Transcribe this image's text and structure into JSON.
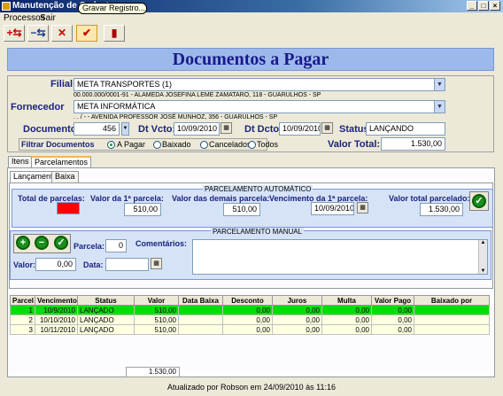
{
  "window": {
    "title": "Manutenção de Cadastro"
  },
  "menu": [
    "Processos",
    "Sair"
  ],
  "toolbar": {
    "tooltip": "Gravar Registro...",
    "buttons": [
      "add-icon",
      "remove-icon",
      "cancel-icon",
      "save-check-icon",
      "exit-door-icon"
    ]
  },
  "heading": "Documentos a Pagar",
  "form": {
    "filial_label": "Filial",
    "filial_value": "META TRANSPORTES (1)",
    "filial_info": "00.000.000/0001-91 - ALAMEDA JOSEFINA LEME ZAMATARO, 118 - GUARULHOS - SP",
    "fornecedor_label": "Fornecedor",
    "fornecedor_value": "META INFORMÁTICA",
    "fornecedor_info": ". . / - - AVENIDA PROFESSOR JOSÉ MUNHOZ, 356 - GUARULHOS - SP",
    "documento_label": "Documento",
    "documento_value": "456",
    "dtvcto_label": "Dt Vcto:",
    "dtvcto_value": "10/09/2010",
    "dtdcto_label": "Dt Dcto:",
    "dtdcto_value": "10/09/2010",
    "status_label": "Status:",
    "status_value": "LANÇANDO",
    "filtrar_label": "Filtrar Documentos",
    "filters": [
      "A Pagar",
      "Baixado",
      "Cancelados",
      "Todos"
    ],
    "filter_selected": "A Pagar",
    "valor_total_label": "Valor Total:",
    "valor_total_value": "1.530,00"
  },
  "tabs": [
    "Itens",
    "Parcelamentos"
  ],
  "subtabs": [
    "Lançamento",
    "Baixa"
  ],
  "auto": {
    "legend": "PARCELAMENTO AUTOMÁTICO",
    "total_parcelas_label": "Total de parcelas:",
    "valor_primeira_label": "Valor da 1ª parcela:",
    "valor_primeira_value": "510,00",
    "valor_demais_label": "Valor das demais parcela:",
    "valor_demais_value": "510,00",
    "vencimento_label": "Vencimento da 1ª parcela:",
    "vencimento_value": "10/09/2010",
    "valor_total_label": "Valor total parcelado:",
    "valor_total_value": "1.530,00"
  },
  "manual": {
    "legend": "PARCELAMENTO MANUAL",
    "parcela_label": "Parcela:",
    "parcela_value": "0",
    "comentarios_label": "Comentários:",
    "valor_label": "Valor:",
    "valor_value": "0,00",
    "data_label": "Data:"
  },
  "grid": {
    "columns": [
      "Parcel",
      "Vencimento",
      "Status",
      "Valor",
      "Data Baixa",
      "Desconto",
      "Juros",
      "Multa",
      "Valor Pago",
      "Baixado por"
    ],
    "rows": [
      [
        "1",
        "10/9/2010",
        "LANÇADO",
        "510,00",
        "",
        "0,00",
        "0,00",
        "0,00",
        "0,00",
        ""
      ],
      [
        "2",
        "10/10/2010",
        "LANÇADO",
        "510,00",
        "",
        "0,00",
        "0,00",
        "0,00",
        "0,00",
        ""
      ],
      [
        "3",
        "10/11/2010",
        "LANÇADO",
        "510,00",
        "",
        "0,00",
        "0,00",
        "0,00",
        "0,00",
        ""
      ]
    ],
    "footer_total": "1.530,00"
  },
  "statusbar": "Atualizado por Robson em 24/09/2010 às 11:16"
}
